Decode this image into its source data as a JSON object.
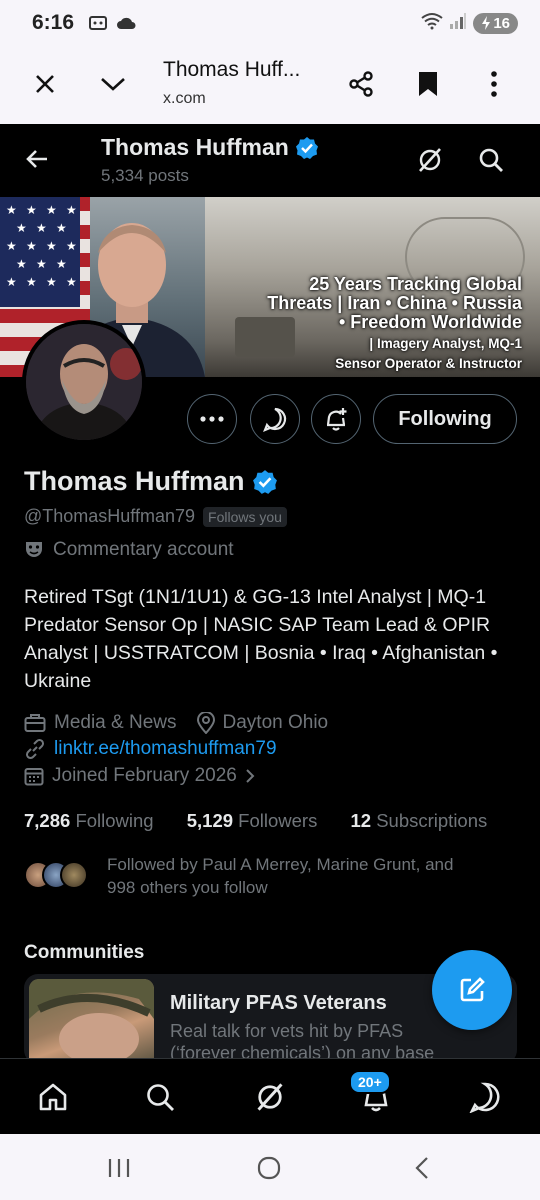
{
  "status_bar": {
    "time": "6:16",
    "battery": "16"
  },
  "custom_tab": {
    "title": "Thomas Huff...",
    "domain": "x.com"
  },
  "header": {
    "name": "Thomas Huffman",
    "posts": "5,334 posts"
  },
  "banner": {
    "line1": "25 Years Tracking Global",
    "line2": "Threats | Iran • China • Russia",
    "line3": "• Freedom Worldwide",
    "line4": "| Imagery Analyst, MQ-1",
    "line5": "Sensor Operator & Instructor"
  },
  "actions": {
    "following_label": "Following"
  },
  "profile": {
    "name": "Thomas Huffman",
    "handle": "@ThomasHuffman79",
    "follows_you": "Follows you",
    "commentary": "Commentary account",
    "bio": "Retired TSgt (1N1/1U1) & GG-13 Intel Analyst | MQ-1 Predator Sensor Op | NASIC SAP Team Lead & OPIR Analyst | USSTRATCOM | Bosnia • Iraq • Afghanistan • Ukraine",
    "category": "Media & News",
    "location": "Dayton Ohio",
    "link": "linktr.ee/thomashuffman79",
    "joined": "Joined February 2026"
  },
  "stats": {
    "following_count": "7,286",
    "following_label": "Following",
    "followers_count": "5,129",
    "followers_label": "Followers",
    "subs_count": "12",
    "subs_label": "Subscriptions"
  },
  "followed_by": {
    "line1": "Followed by Paul A Merrey, Marine Grunt, and",
    "line2": "998 others you follow"
  },
  "communities": {
    "heading": "Communities",
    "card_title": "Military PFAS Veterans",
    "card_desc_1": "Real talk for vets hit by PFAS",
    "card_desc_2": "(‘forever chemicals’) on any base"
  },
  "bottom_nav": {
    "notifications_badge": "20+"
  },
  "colors": {
    "accent": "#1d9bf0",
    "muted": "#71767b",
    "text": "#e7e9ea",
    "background": "#000000"
  },
  "icons": [
    "close-icon",
    "chevron-down-icon",
    "share-icon",
    "bookmark-icon",
    "more-vert-icon",
    "back-arrow-icon",
    "grok-icon",
    "search-icon",
    "verified-icon",
    "more-horiz-icon",
    "message-icon",
    "bell-plus-icon",
    "theater-mask-icon",
    "briefcase-icon",
    "location-icon",
    "link-icon",
    "calendar-icon",
    "compose-icon",
    "home-icon",
    "bell-icon",
    "chat-icon"
  ]
}
